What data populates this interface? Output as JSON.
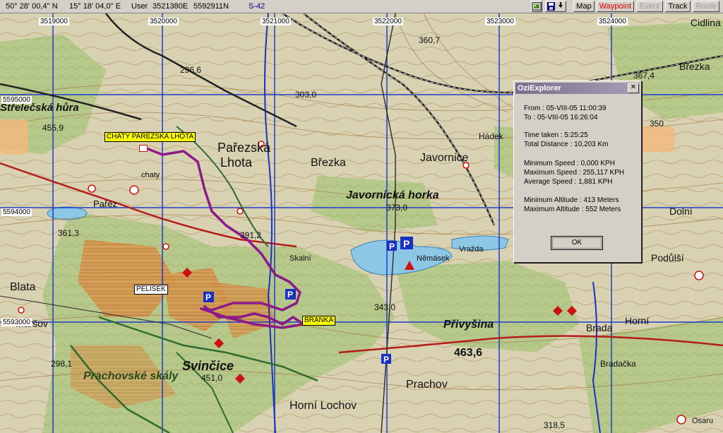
{
  "toolbar": {
    "lat": "50° 28' 00,4'' N",
    "lon": "15° 18' 04,0'' E",
    "user_prefix": "User",
    "user_east": "3521380E",
    "user_north": "5592911N",
    "datum": "S-42",
    "buttons": {
      "map": "Map",
      "waypoint": "Waypoint",
      "event": "Event",
      "track": "Track",
      "route": "Route"
    },
    "accent_red": "#e00000"
  },
  "map": {
    "grid_x_labels": [
      "3519000",
      "3520000",
      "3521000",
      "3522000",
      "3523000",
      "3524000"
    ],
    "grid_y_labels": [
      "5595000",
      "5594000",
      "5593000"
    ],
    "place_names": {
      "streletska": "Střelečská hůra",
      "parezska": "Pařezská",
      "lhota": "Lhota",
      "brezka": "Březka",
      "javornice": "Javornice",
      "javornicka": "Javornická horka",
      "blata": "Blata",
      "marsov": "Maršov",
      "prachov": "Prachov",
      "horni_lochov": "Horní Lochov",
      "pruvysina": "Přivyšina",
      "prachovske_skaly": "Prachovské skály",
      "svincice": "Svinčice",
      "horni": "Horní",
      "brada": "Brada",
      "bradacka": "Bradačka",
      "dolni": "Dolní",
      "podulsi": "Podůlší",
      "cidlina": "Cidlina",
      "brezka_e": "Březka",
      "hradek": "Hádek",
      "skalni": "Skalní",
      "chaty": "chaty",
      "parez": "Pařez",
      "vrazda": "Vražda",
      "nemasek": "Němásek",
      "osaru": "Osaru"
    },
    "elevations": {
      "e1": "360,7",
      "e2": "367,4",
      "e3": "296,6",
      "e4": "303,0",
      "e5": "455,9",
      "e6": "373,0",
      "e7": "391,2",
      "e8": "361,3",
      "e9": "343,0",
      "e10": "463,6",
      "e11": "298,1",
      "e12": "451,0",
      "e13": "318,5",
      "e14": "350"
    },
    "waypoints": {
      "chaty": "CHATY PAREZSKA LHOTA",
      "pelisek": "PELISEK",
      "branka": "BRANKA"
    }
  },
  "dialog": {
    "title": "OziExplorer",
    "close": "✕",
    "from": "From : 05-VIII-05 11:00:39",
    "to": "To : 05-VIII-05 16:26:04",
    "time_taken": "Time taken : 5:25:25",
    "total_distance": "Total Distance : 10,203 Km",
    "min_speed": "Minimum Speed : 0,000 KPH",
    "max_speed": "Maximum Speed : 255,117 KPH",
    "avg_speed": "Average Speed : 1,881 KPH",
    "min_alt": "Minimum Altitude : 413 Meters",
    "max_alt": "Maximum Altitude : 552 Meters",
    "ok": "OK"
  }
}
